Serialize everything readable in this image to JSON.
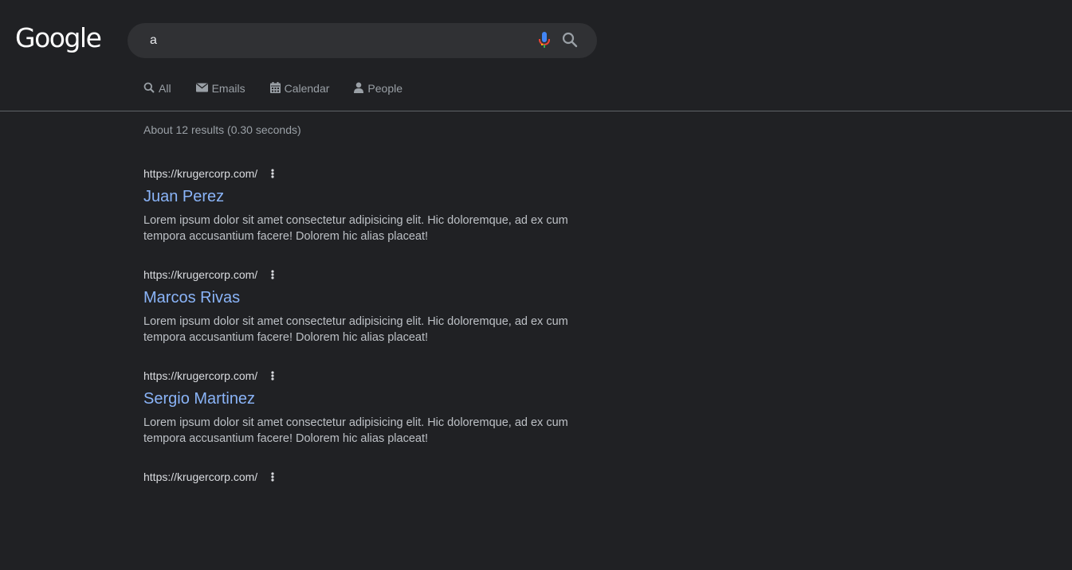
{
  "logo": "Google",
  "search": {
    "query": "a"
  },
  "tabs": [
    {
      "label": "All",
      "icon": "search-icon"
    },
    {
      "label": "Emails",
      "icon": "mail-icon"
    },
    {
      "label": "Calendar",
      "icon": "calendar-icon"
    },
    {
      "label": "People",
      "icon": "person-icon"
    }
  ],
  "stats": "About 12 results (0.30 seconds)",
  "results": [
    {
      "url": "https://krugercorp.com/",
      "title": "Juan Perez",
      "snippet": "Lorem ipsum dolor sit amet consectetur adipisicing elit. Hic doloremque, ad ex cum tempora accusantium facere! Dolorem hic alias placeat!"
    },
    {
      "url": "https://krugercorp.com/",
      "title": "Marcos Rivas",
      "snippet": "Lorem ipsum dolor sit amet consectetur adipisicing elit. Hic doloremque, ad ex cum tempora accusantium facere! Dolorem hic alias placeat!"
    },
    {
      "url": "https://krugercorp.com/",
      "title": "Sergio Martinez",
      "snippet": "Lorem ipsum dolor sit amet consectetur adipisicing elit. Hic doloremque, ad ex cum tempora accusantium facere! Dolorem hic alias placeat!"
    },
    {
      "url": "https://krugercorp.com/",
      "title": "",
      "snippet": ""
    }
  ],
  "colors": {
    "background": "#202124",
    "link": "#8ab4f8",
    "searchbox": "#303134"
  }
}
